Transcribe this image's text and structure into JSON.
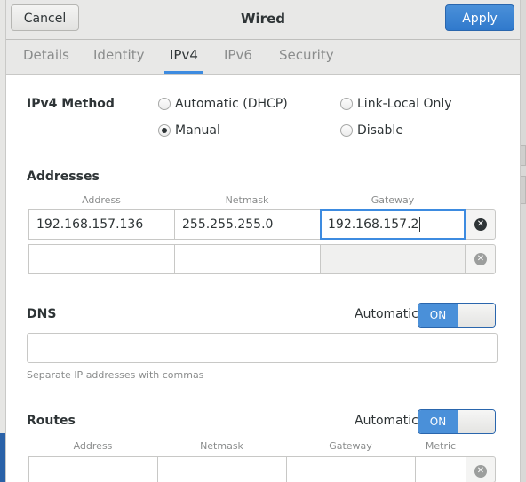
{
  "header": {
    "cancel_label": "Cancel",
    "title": "Wired",
    "apply_label": "Apply"
  },
  "tabs": [
    {
      "label": "Details"
    },
    {
      "label": "Identity"
    },
    {
      "label": "IPv4"
    },
    {
      "label": "IPv6"
    },
    {
      "label": "Security"
    }
  ],
  "active_tab": "IPv4",
  "ipv4_method": {
    "label": "IPv4 Method",
    "options": [
      {
        "label": "Automatic (DHCP)",
        "selected": false
      },
      {
        "label": "Link-Local Only",
        "selected": false
      },
      {
        "label": "Manual",
        "selected": true
      },
      {
        "label": "Disable",
        "selected": false
      }
    ]
  },
  "addresses": {
    "label": "Addresses",
    "columns": [
      "Address",
      "Netmask",
      "Gateway"
    ],
    "rows": [
      {
        "address": "192.168.157.136",
        "netmask": "255.255.255.0",
        "gateway": "192.168.157.2"
      },
      {
        "address": "",
        "netmask": "",
        "gateway": ""
      }
    ]
  },
  "dns": {
    "label": "DNS",
    "automatic_label": "Automatic",
    "switch_label": "ON",
    "value": "",
    "hint": "Separate IP addresses with commas"
  },
  "routes": {
    "label": "Routes",
    "automatic_label": "Automatic",
    "switch_label": "ON",
    "columns": [
      "Address",
      "Netmask",
      "Gateway",
      "Metric"
    ]
  },
  "colors": {
    "accent": "#4a90d9",
    "tab_indicator": "#3d8be0"
  }
}
